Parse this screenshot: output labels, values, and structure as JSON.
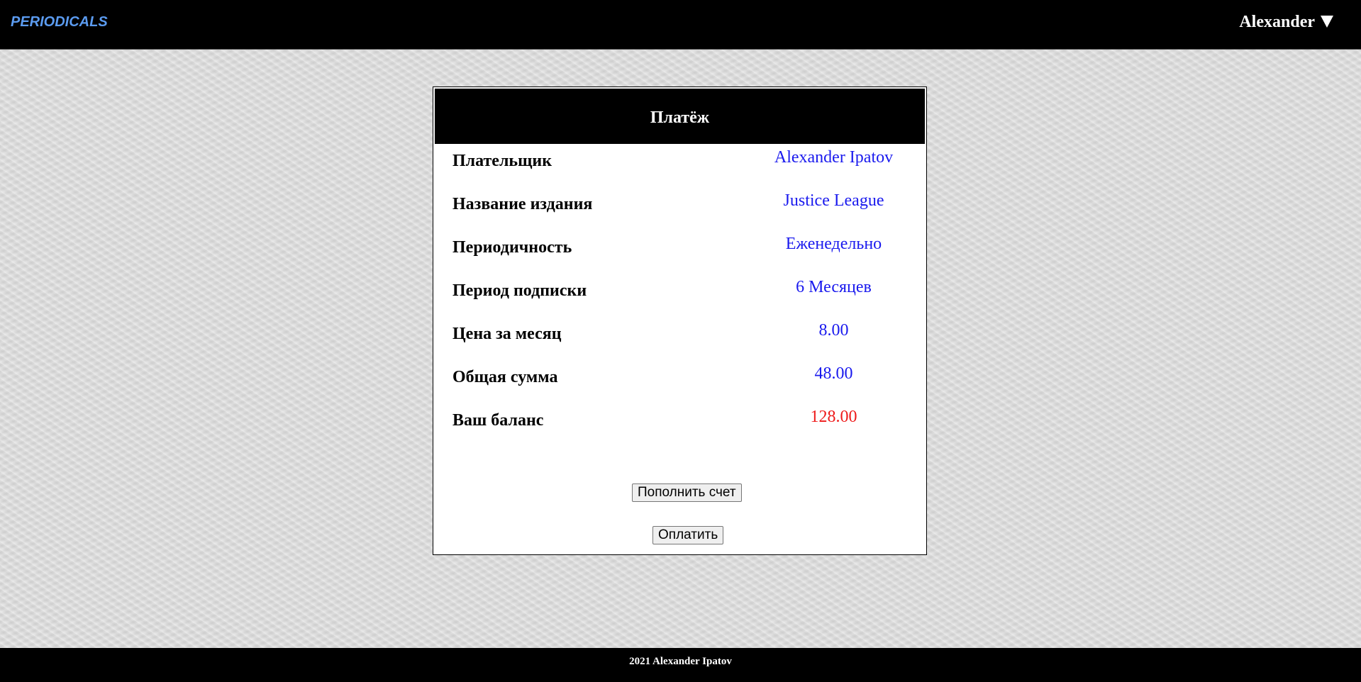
{
  "header": {
    "logo": "PERIODICALS",
    "user_name": "Alexander",
    "user_menu_icon": "caret-down-icon"
  },
  "payment": {
    "title": "Платёж",
    "rows": [
      {
        "label": "Плательщик",
        "value": "Alexander Ipatov"
      },
      {
        "label": "Название издания",
        "value": "Justice League"
      },
      {
        "label": "Периодичность",
        "value": "Еженедельно"
      },
      {
        "label": "Период подписки",
        "value": "6 Месяцев"
      },
      {
        "label": "Цена за месяц",
        "value": "8.00"
      },
      {
        "label": "Общая сумма",
        "value": "48.00"
      },
      {
        "label": "Ваш баланс",
        "value": "128.00"
      }
    ],
    "top_up_button": "Пополнить счет",
    "pay_button": "Оплатить"
  },
  "colors": {
    "value_text": "#1a1aee",
    "balance_text": "#ee1a1a",
    "logo": "#5b9bf0"
  },
  "footer": {
    "text": "2021 Alexander Ipatov"
  }
}
